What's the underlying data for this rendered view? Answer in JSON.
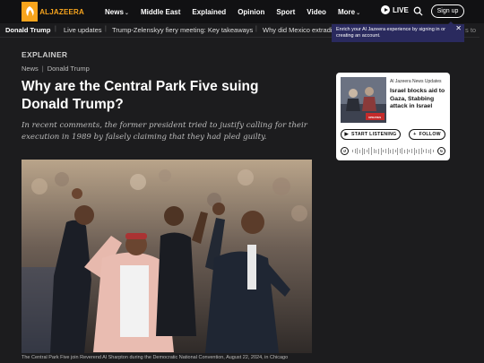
{
  "logo": {
    "text": "ALJAZEERA"
  },
  "nav": {
    "items": [
      {
        "label": "News",
        "has_dropdown": true
      },
      {
        "label": "Middle East",
        "has_dropdown": false
      },
      {
        "label": "Explained",
        "has_dropdown": false
      },
      {
        "label": "Opinion",
        "has_dropdown": false
      },
      {
        "label": "Sport",
        "has_dropdown": false
      },
      {
        "label": "Video",
        "has_dropdown": false
      },
      {
        "label": "More",
        "has_dropdown": true
      }
    ],
    "live_label": "LIVE",
    "search_icon": "search-icon",
    "signup_label": "Sign up"
  },
  "subbar": {
    "active": "Donald Trump",
    "items": [
      "Live updates",
      "Trump-Zelenskyy fiery meeting: Key takeaways",
      "Why did Mexico extradit"
    ]
  },
  "tooltip": {
    "text": "Enrich your Al Jazeera experience by signing in or creating an account.",
    "close": "✕"
  },
  "article": {
    "kicker": "EXPLAINER",
    "breadcrumb": [
      "News",
      "Donald Trump"
    ],
    "title": "Why are the Central Park Five suing Donald Trump?",
    "standfirst": "In recent comments, the former president tried to justify calling for their execution in 1989 by falsely claiming that they had pled guilty.",
    "caption": "The Central Park Five join Reverend Al Sharpton during the Democratic National Convention, August 22, 2024, in Chicago"
  },
  "player": {
    "source": "Al Jazeera News Updates",
    "title": "Israel blocks aid to Gaza, Stabbing attack in Israel",
    "listen_label": "START LISTENING",
    "follow_label": "FOLLOW",
    "thumb_label": "UPDATES"
  },
  "colors": {
    "brand": "#f7a41d",
    "background": "#1c1c1e",
    "tooltip": "#2a2a5e"
  }
}
